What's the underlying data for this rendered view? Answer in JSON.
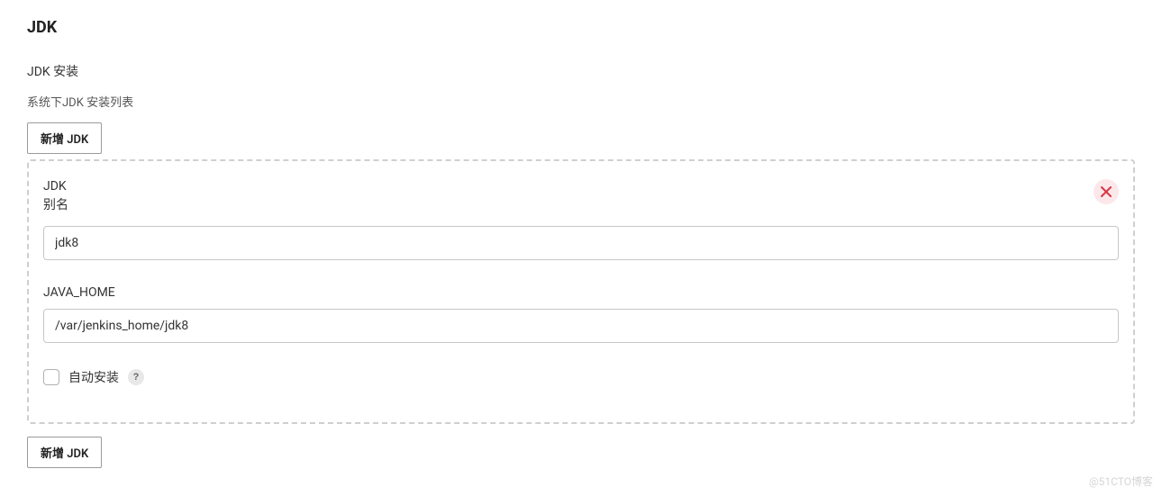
{
  "section": {
    "title": "JDK",
    "install_label": "JDK 安装",
    "list_description": "系统下JDK 安装列表",
    "add_button_label": "新增 JDK"
  },
  "panel": {
    "heading_line1": "JDK",
    "heading_line2": "别名",
    "alias_value": "jdk8",
    "java_home_label": "JAVA_HOME",
    "java_home_value": "/var/jenkins_home/jdk8",
    "auto_install_label": "自动安装",
    "auto_install_checked": false,
    "help_symbol": "?"
  },
  "footer": {
    "add_button_label": "新增 JDK"
  },
  "watermark": "@51CTO博客"
}
